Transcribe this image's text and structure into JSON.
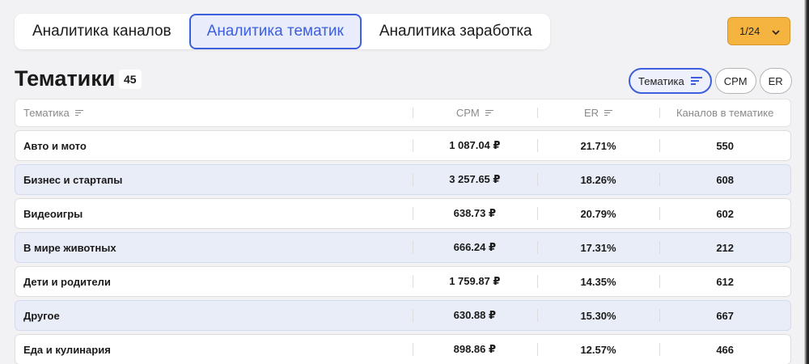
{
  "tabs": [
    {
      "label": "Аналитика каналов",
      "active": false
    },
    {
      "label": "Аналитика тематик",
      "active": true
    },
    {
      "label": "Аналитика заработка",
      "active": false
    }
  ],
  "page_select": {
    "value": "1/24",
    "icon": "chevron-down-icon"
  },
  "heading": {
    "title": "Тематики",
    "count": "45"
  },
  "sort_buttons": [
    {
      "label": "Тематика",
      "active": true,
      "icon": "filter-icon"
    },
    {
      "label": "CPM",
      "active": false
    },
    {
      "label": "ER",
      "active": false
    }
  ],
  "table": {
    "columns": [
      "Тематика",
      "CPM",
      "ER",
      "Каналов в тематике"
    ],
    "rows": [
      {
        "topic": "Авто и мото",
        "cpm": "1 087.04 ₽",
        "er": "21.71%",
        "channels": "550"
      },
      {
        "topic": "Бизнес и стартапы",
        "cpm": "3 257.65 ₽",
        "er": "18.26%",
        "channels": "608"
      },
      {
        "topic": "Видеоигры",
        "cpm": "638.73 ₽",
        "er": "20.79%",
        "channels": "602"
      },
      {
        "topic": "В мире животных",
        "cpm": "666.24 ₽",
        "er": "17.31%",
        "channels": "212"
      },
      {
        "topic": "Дети и родители",
        "cpm": "1 759.87 ₽",
        "er": "14.35%",
        "channels": "612"
      },
      {
        "topic": "Другое",
        "cpm": "630.88 ₽",
        "er": "15.30%",
        "channels": "667"
      },
      {
        "topic": "Еда и кулинария",
        "cpm": "898.86 ₽",
        "er": "12.57%",
        "channels": "466"
      }
    ]
  },
  "colors": {
    "accent": "#3d5fdc",
    "active_tab_bg": "#e8ecfb",
    "page_select_bg": "#f5b340",
    "alt_row_bg": "#e9edf8",
    "page_bg": "#f2f2f4"
  }
}
